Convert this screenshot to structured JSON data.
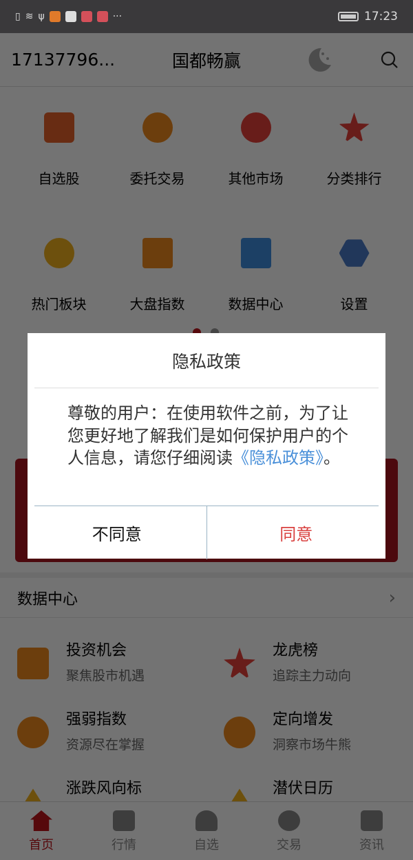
{
  "status": {
    "time": "17:23",
    "more": "···"
  },
  "header": {
    "account": "17137796...",
    "title": "国都畅赢"
  },
  "grid": [
    {
      "label": "自选股",
      "color": "#e8612a"
    },
    {
      "label": "委托交易",
      "color": "#f08a1c"
    },
    {
      "label": "其他市场",
      "color": "#e8403a"
    },
    {
      "label": "分类排行",
      "color": "#e8403a"
    },
    {
      "label": "热门板块",
      "color": "#f3b21c"
    },
    {
      "label": "大盘指数",
      "color": "#f08a1c"
    },
    {
      "label": "数据中心",
      "color": "#3e8ee0"
    },
    {
      "label": "设置",
      "color": "#4a7bc8"
    }
  ],
  "section": {
    "title": "数据中心",
    "chevron": "›"
  },
  "items": [
    {
      "title": "投资机会",
      "sub": "聚焦股市机遇",
      "color": "#f08a1c"
    },
    {
      "title": "龙虎榜",
      "sub": "追踪主力动向",
      "color": "#e8403a"
    },
    {
      "title": "强弱指数",
      "sub": "资源尽在掌握",
      "color": "#f08a1c"
    },
    {
      "title": "定向增发",
      "sub": "洞察市场牛熊",
      "color": "#f08a1c"
    },
    {
      "title": "涨跌风向标",
      "sub": "",
      "color": "#f3b21c"
    },
    {
      "title": "潜伏日历",
      "sub": "",
      "color": "#f3b21c"
    }
  ],
  "tabs": [
    {
      "label": "首页",
      "active": true
    },
    {
      "label": "行情"
    },
    {
      "label": "自选"
    },
    {
      "label": "交易"
    },
    {
      "label": "资讯"
    }
  ],
  "dialog": {
    "title": "隐私政策",
    "body": "尊敬的用户：在使用软件之前，为了让您更好地了解我们是如何保护用户的个人信息，请您仔细阅读",
    "link": "《隐私政策》",
    "end": "。",
    "decline": "不同意",
    "accept": "同意"
  }
}
